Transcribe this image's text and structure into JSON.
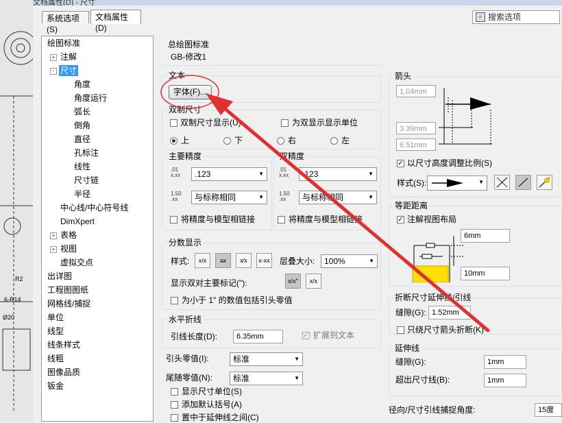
{
  "window": {
    "title": "文档属性(D) - 尺寸"
  },
  "tabs": [
    {
      "label": "系统选项(S)",
      "active": false
    },
    {
      "label": "文档属性(D)",
      "active": true
    }
  ],
  "search": {
    "label": "搜索选项"
  },
  "tree": [
    {
      "label": "绘图标准",
      "level": 0,
      "expander": ""
    },
    {
      "label": "注解",
      "level": 1,
      "expander": "+"
    },
    {
      "label": "尺寸",
      "level": 1,
      "expander": "-",
      "selected": true
    },
    {
      "label": "角度",
      "level": 2
    },
    {
      "label": "角度运行",
      "level": 2
    },
    {
      "label": "弧长",
      "level": 2
    },
    {
      "label": "倒角",
      "level": 2
    },
    {
      "label": "直径",
      "level": 2
    },
    {
      "label": "孔标注",
      "level": 2
    },
    {
      "label": "线性",
      "level": 2
    },
    {
      "label": "尺寸链",
      "level": 2
    },
    {
      "label": "半径",
      "level": 2
    },
    {
      "label": "中心线/中心符号线",
      "level": 1
    },
    {
      "label": "DimXpert",
      "level": 1
    },
    {
      "label": "表格",
      "level": 1,
      "expander": "+"
    },
    {
      "label": "视图",
      "level": 1,
      "expander": "+"
    },
    {
      "label": "虚拟交点",
      "level": 1
    },
    {
      "label": "出详图",
      "level": 0
    },
    {
      "label": "工程图图纸",
      "level": 0
    },
    {
      "label": "网格线/捕捉",
      "level": 0
    },
    {
      "label": "单位",
      "level": 0
    },
    {
      "label": "线型",
      "level": 0
    },
    {
      "label": "线条样式",
      "level": 0
    },
    {
      "label": "线粗",
      "level": 0
    },
    {
      "label": "图像品质",
      "level": 0
    },
    {
      "label": "钣金",
      "level": 0
    }
  ],
  "overall_standard": {
    "title": "总绘图标准",
    "value": "GB-修改1"
  },
  "text": {
    "title": "文本",
    "font_button": "字体(F)..."
  },
  "dual": {
    "title": "双制尺寸",
    "show_dual": "双制尺寸显示(U)",
    "show_units": "为双显示显示单位",
    "positions": [
      "上",
      "下",
      "右",
      "左"
    ],
    "selected": "上"
  },
  "primary_precision": {
    "title": "主要精度",
    "value": ".123",
    "tol_value": "与标称相同",
    "link": "将精度与模型相链接",
    "icon1": ".01 x.xx .01",
    "icon2": "1.50 .xx .xx"
  },
  "dual_precision": {
    "title": "双精度",
    "value": ".123",
    "tol_value": "与标称相同",
    "link": "将精度与模型相链接"
  },
  "fraction": {
    "title": "分数显示",
    "style_label": "样式:",
    "style_buttons": [
      "x/x",
      "x̶x",
      "x⁄x",
      "x-xx"
    ],
    "stack_label": "层叠大小:",
    "stack_value": "100%",
    "dual_mark_label": "显示双对主要标记(\"):",
    "dual_mark_buttons": [
      "x/x″",
      "x/x"
    ],
    "leading_zero": "为小于 1\" 的数值包括引头零值"
  },
  "horizontal_break": {
    "title": "水平折线",
    "leader_length_label": "引线长度(D):",
    "leader_length": "6.35mm",
    "extend_text": "扩展到文本"
  },
  "leading_zeros": {
    "label": "引头零值(I):",
    "value": "标准"
  },
  "trailing_zeros": {
    "label": "尾随零值(N):",
    "value": "标准"
  },
  "extra_checks": [
    "显示尺寸单位(S)",
    "添加默认括号(A)",
    "置中于延伸线之间(C)"
  ],
  "arrows": {
    "title": "箭头",
    "size1": "1.04mm",
    "size2": "3.39mm",
    "size3": "6.51mm",
    "scale_label": "以尺寸高度调整比例(S)",
    "style_label": "样式(S):"
  },
  "offset": {
    "title": "等距距离",
    "annotate_label": "注解视图布局",
    "value1": "6mm",
    "value2": "10mm"
  },
  "break_lines": {
    "title": "折断尺寸延伸线/引线",
    "gap_label": "缝隙(G):",
    "gap_value": "1.52mm",
    "only_arrow": "只绕尺寸箭头折断(K)"
  },
  "extension": {
    "title": "延伸线",
    "gap_label": "缝隙(G):",
    "gap_value": "1mm",
    "beyond_label": "超出尺寸线(B):",
    "beyond_value": "1mm"
  },
  "radial": {
    "label": "径向/尺寸引线捕捉角度:",
    "value": "15度"
  },
  "colors": {
    "highlight_circle": "#e03030",
    "arrow": "#e03030",
    "selection": "#3399ff"
  }
}
